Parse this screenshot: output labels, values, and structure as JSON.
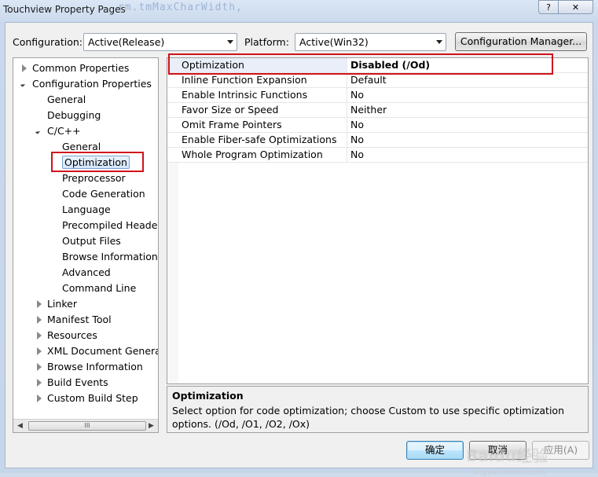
{
  "window": {
    "title": "Touchview Property Pages",
    "background_code": "rm.tmMaxCharWidth,",
    "help_label": "?",
    "close_label": "✕"
  },
  "config_bar": {
    "configuration_label": "Configuration:",
    "configuration_value": "Active(Release)",
    "platform_label": "Platform:",
    "platform_value": "Active(Win32)",
    "config_manager_label": "Configuration Manager..."
  },
  "tree": {
    "items": [
      {
        "label": "Common Properties",
        "expander": "closed"
      },
      {
        "label": "Configuration Properties",
        "expander": "open"
      },
      {
        "label": "General",
        "expander": "none"
      },
      {
        "label": "Debugging",
        "expander": "none"
      },
      {
        "label": "C/C++",
        "expander": "open"
      },
      {
        "label": "General",
        "expander": "none"
      },
      {
        "label": "Optimization",
        "expander": "none",
        "selected": true
      },
      {
        "label": "Preprocessor",
        "expander": "none"
      },
      {
        "label": "Code Generation",
        "expander": "none"
      },
      {
        "label": "Language",
        "expander": "none"
      },
      {
        "label": "Precompiled Headers",
        "expander": "none"
      },
      {
        "label": "Output Files",
        "expander": "none"
      },
      {
        "label": "Browse Information",
        "expander": "none"
      },
      {
        "label": "Advanced",
        "expander": "none"
      },
      {
        "label": "Command Line",
        "expander": "none"
      },
      {
        "label": "Linker",
        "expander": "closed"
      },
      {
        "label": "Manifest Tool",
        "expander": "closed"
      },
      {
        "label": "Resources",
        "expander": "closed"
      },
      {
        "label": "XML Document Generator",
        "expander": "closed"
      },
      {
        "label": "Browse Information",
        "expander": "closed"
      },
      {
        "label": "Build Events",
        "expander": "closed"
      },
      {
        "label": "Custom Build Step",
        "expander": "closed"
      }
    ],
    "scroll_thumb_grip": "III"
  },
  "properties": [
    {
      "name": "Optimization",
      "value": "Disabled (/Od)",
      "selected": true
    },
    {
      "name": "Inline Function Expansion",
      "value": "Default"
    },
    {
      "name": "Enable Intrinsic Functions",
      "value": "No"
    },
    {
      "name": "Favor Size or Speed",
      "value": "Neither"
    },
    {
      "name": "Omit Frame Pointers",
      "value": "No"
    },
    {
      "name": "Enable Fiber-safe Optimizations",
      "value": "No"
    },
    {
      "name": "Whole Program Optimization",
      "value": "No"
    }
  ],
  "description": {
    "title": "Optimization",
    "text": "Select option for code optimization; choose Custom to use specific optimization options.     (/Od, /O1, /O2, /Ox)"
  },
  "buttons": {
    "ok": "确定",
    "cancel": "取消",
    "apply": "应用(A)"
  },
  "watermark": {
    "brand": "Baidu经验",
    "url": "jingyan.baidu.com"
  },
  "colors": {
    "highlight_box": "#d0121b",
    "selection": "#d4e6fb"
  }
}
